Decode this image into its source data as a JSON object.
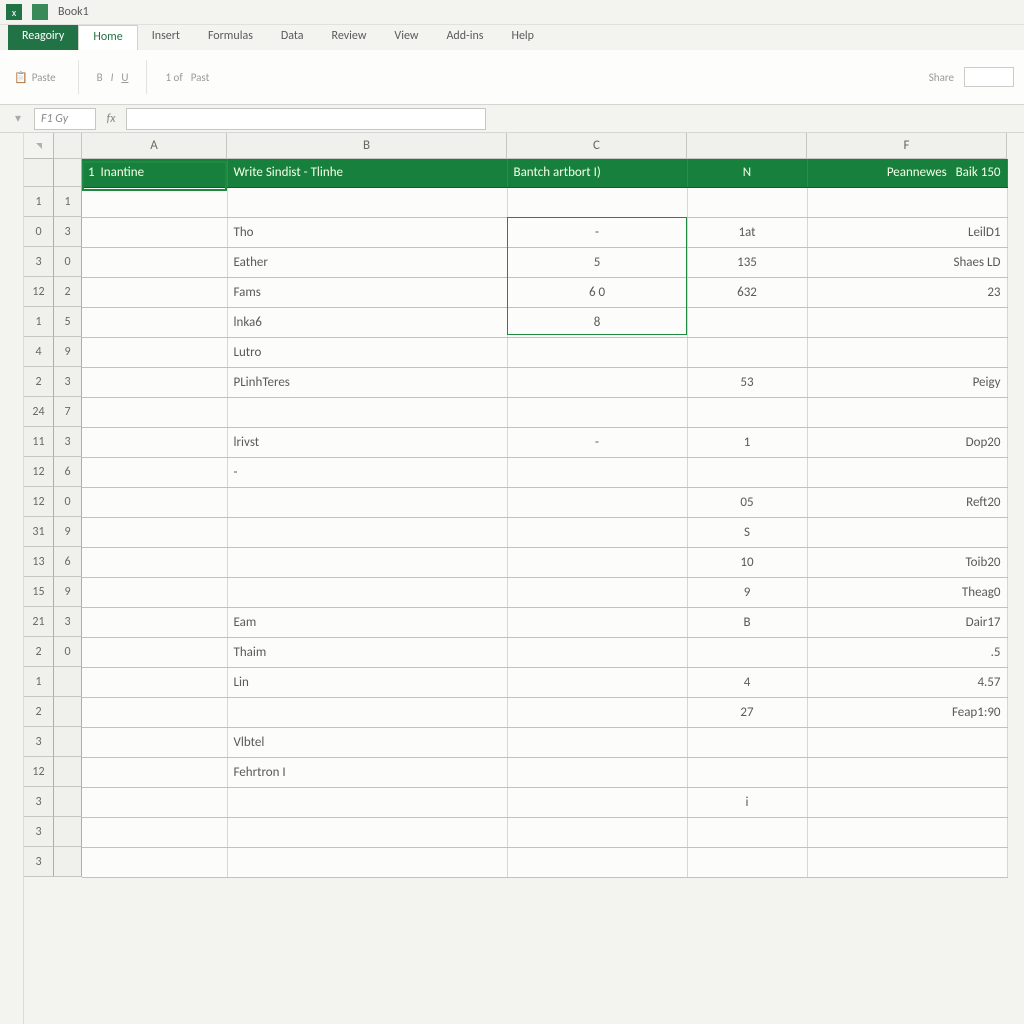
{
  "titlebar": {
    "doc": "Book1"
  },
  "ribbon": {
    "file": "Reagoiry",
    "tabs": [
      "Home",
      "Insert",
      "Formulas",
      "Data",
      "Review",
      "View",
      "Add-ins",
      "Help"
    ],
    "hints": [
      "Paste",
      "1 of",
      "Past"
    ],
    "right": [
      "Share"
    ]
  },
  "fx": {
    "name": "F1 Gy",
    "value": ""
  },
  "columns": [
    "A",
    "B",
    "C",
    "F"
  ],
  "table_header": {
    "a_left": "1",
    "a": "Inantine",
    "b": "Write Sindist   -   Tlinhe",
    "c": "Bantch artbort I)",
    "n": "N",
    "f1": "Peannewes",
    "f2": "Baik  150"
  },
  "rows": [
    {
      "rn": "1",
      "a": "1",
      "b": "",
      "c": "",
      "n": "",
      "f": ""
    },
    {
      "rn": "0",
      "a": "3",
      "b": "Tho",
      "c": "-",
      "n": "1at",
      "f": "LeilD1"
    },
    {
      "rn": "3",
      "a": "0",
      "b": "Eather",
      "c": "5",
      "n": "135",
      "f": "Shaes LD"
    },
    {
      "rn": "12",
      "a": "2",
      "b": "Fams",
      "c": "6                0",
      "n": "632",
      "f": "23"
    },
    {
      "rn": "1",
      "a": "5",
      "b": "lnka6",
      "c": "8",
      "n": "",
      "f": ""
    },
    {
      "rn": "4",
      "a": "9",
      "b": "Lutro",
      "c": "",
      "n": "",
      "f": ""
    },
    {
      "rn": "2",
      "a": "3",
      "b": "PLinhTeres",
      "c": "",
      "n": "53",
      "f": "Peigy"
    },
    {
      "rn": "24",
      "a": "7",
      "b": "",
      "c": "",
      "n": "",
      "f": ""
    },
    {
      "rn": "11",
      "a": "3",
      "b": "lrivst",
      "c": "-",
      "n": "1",
      "f": "Dop20"
    },
    {
      "rn": "12",
      "a": "6",
      "b": "-",
      "c": "",
      "n": "",
      "f": ""
    },
    {
      "rn": "12",
      "a": "0",
      "b": "",
      "c": "",
      "n": "05",
      "f": "Reft20"
    },
    {
      "rn": "31",
      "a": "9",
      "b": "",
      "c": "",
      "n": "S",
      "f": ""
    },
    {
      "rn": "13",
      "a": "6",
      "b": "",
      "c": "",
      "n": "10",
      "f": "Toib20"
    },
    {
      "rn": "15",
      "a": "9",
      "b": "",
      "c": "",
      "n": "9",
      "f": "Theag0"
    },
    {
      "rn": "21",
      "a": "3",
      "b": "Eam",
      "c": "",
      "n": "B",
      "f": "Dair17"
    },
    {
      "rn": "2",
      "a": "0",
      "b": "Thaim",
      "c": "",
      "n": "",
      "f": ".5"
    },
    {
      "rn": "1",
      "a": "",
      "b": "Lin",
      "c": "",
      "n": "4",
      "f": "4.57"
    },
    {
      "rn": "2",
      "a": "",
      "b": "",
      "c": "",
      "n": "27",
      "f": "Feap1:90"
    },
    {
      "rn": "3",
      "a": "",
      "b": "Vlbtel",
      "c": "",
      "n": "",
      "f": ""
    },
    {
      "rn": "12",
      "a": "",
      "b": "Fehrtron    I",
      "c": "",
      "n": "",
      "f": ""
    },
    {
      "rn": "3",
      "a": "",
      "b": "",
      "c": "",
      "n": "i",
      "f": ""
    },
    {
      "rn": "3",
      "a": "",
      "b": "",
      "c": "",
      "n": "",
      "f": ""
    },
    {
      "rn": "3",
      "a": "",
      "b": "",
      "c": "",
      "n": "",
      "f": ""
    }
  ],
  "col_widths": {
    "A": 145,
    "B": 280,
    "C": 180,
    "N": 120,
    "F": 200
  }
}
